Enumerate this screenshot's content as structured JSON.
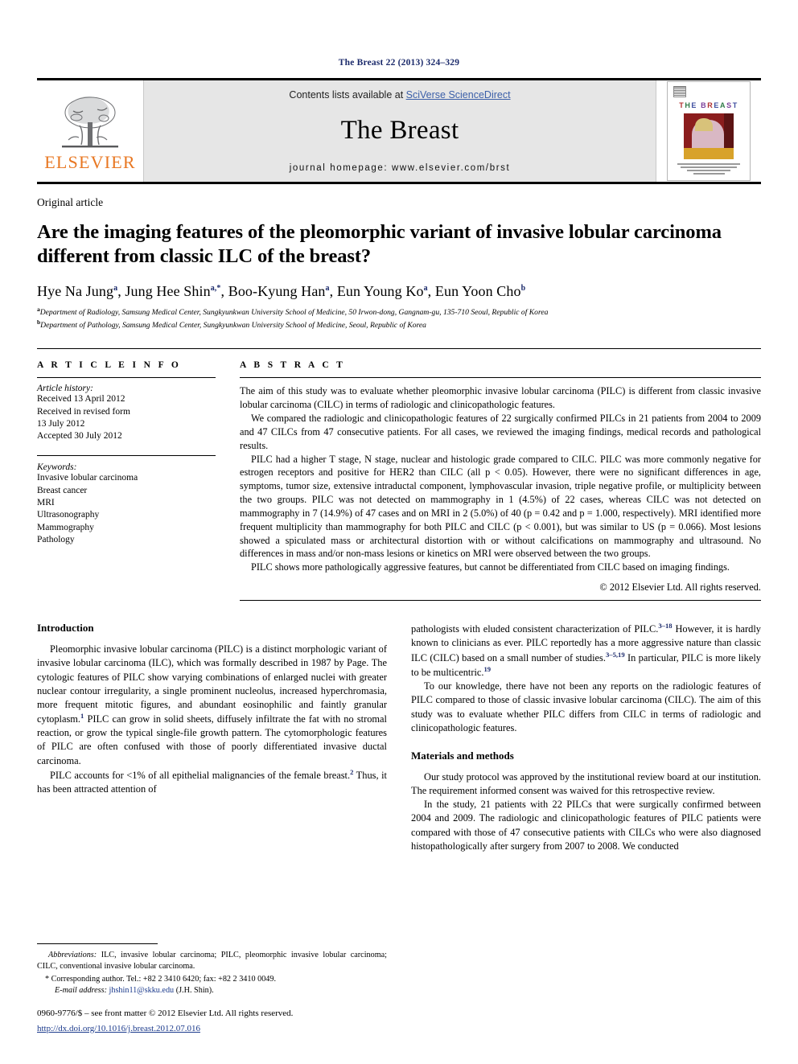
{
  "running_head": "The Breast 22 (2013) 324–329",
  "masthead": {
    "contents_prefix": "Contents lists available at ",
    "sciencedirect": "SciVerse ScienceDirect",
    "journal_name": "The Breast",
    "homepage": "journal homepage: www.elsevier.com/brst",
    "publisher_logo_text": "ELSEVIER",
    "cover_title_parts": [
      "T",
      "H",
      "E",
      "B",
      "R",
      "E",
      "A",
      "S",
      "T"
    ]
  },
  "article": {
    "type": "Original article",
    "title": "Are the imaging features of the pleomorphic variant of invasive lobular carcinoma different from classic ILC of the breast?",
    "authors_html": "Hye Na Jung a, Jung Hee Shin a,*, Boo-Kyung Han a, Eun Young Ko a, Eun Yoon Cho b",
    "affiliation_a": "Department of Radiology, Samsung Medical Center, Sungkyunkwan University School of Medicine, 50 Irwon-dong, Gangnam-gu, 135-710 Seoul, Republic of Korea",
    "affiliation_b": "Department of Pathology, Samsung Medical Center, Sungkyunkwan University School of Medicine, Seoul, Republic of Korea"
  },
  "article_info": {
    "heading": "A R T I C L E   I N F O",
    "history_title": "Article history:",
    "history": [
      "Received 13 April 2012",
      "Received in revised form",
      "13 July 2012",
      "Accepted 30 July 2012"
    ],
    "keywords_title": "Keywords:",
    "keywords": [
      "Invasive lobular carcinoma",
      "Breast cancer",
      "MRI",
      "Ultrasonography",
      "Mammography",
      "Pathology"
    ]
  },
  "abstract": {
    "heading": "A B S T R A C T",
    "paragraphs": [
      "The aim of this study was to evaluate whether pleomorphic invasive lobular carcinoma (PILC) is different from classic invasive lobular carcinoma (CILC) in terms of radiologic and clinicopathologic features.",
      "We compared the radiologic and clinicopathologic features of 22 surgically confirmed PILCs in 21 patients from 2004 to 2009 and 47 CILCs from 47 consecutive patients. For all cases, we reviewed the imaging findings, medical records and pathological results.",
      "PILC had a higher T stage, N stage, nuclear and histologic grade compared to CILC. PILC was more commonly negative for estrogen receptors and positive for HER2 than CILC (all p < 0.05). However, there were no significant differences in age, symptoms, tumor size, extensive intraductal component, lymphovascular invasion, triple negative profile, or multiplicity between the two groups. PILC was not detected on mammography in 1 (4.5%) of 22 cases, whereas CILC was not detected on mammography in 7 (14.9%) of 47 cases and on MRI in 2 (5.0%) of 40 (p = 0.42 and p = 1.000, respectively). MRI identified more frequent multiplicity than mammography for both PILC and CILC (p < 0.001), but was similar to US (p = 0.066). Most lesions showed a spiculated mass or architectural distortion with or without calcifications on mammography and ultrasound. No differences in mass and/or non-mass lesions or kinetics on MRI were observed between the two groups.",
      "PILC shows more pathologically aggressive features, but cannot be differentiated from CILC based on imaging findings."
    ],
    "copyright": "© 2012 Elsevier Ltd. All rights reserved."
  },
  "body": {
    "intro_heading": "Introduction",
    "intro_p1": "Pleomorphic invasive lobular carcinoma (PILC) is a distinct morphologic variant of invasive lobular carcinoma (ILC), which was formally described in 1987 by Page. The cytologic features of PILC show varying combinations of enlarged nuclei with greater nuclear contour irregularity, a single prominent nucleolus, increased hyperchromasia, more frequent mitotic figures, and abundant eosinophilic and faintly granular cytoplasm.1 PILC can grow in solid sheets, diffusely infiltrate the fat with no stromal reaction, or grow the typical single-file growth pattern. The cytomorphologic features of PILC are often confused with those of poorly differentiated invasive ductal carcinoma.",
    "intro_p2": "PILC accounts for <1% of all epithelial malignancies of the female breast.2 Thus, it has been attracted attention of",
    "intro_p3": "pathologists with eluded consistent characterization of PILC.3–18 However, it is hardly known to clinicians as ever. PILC reportedly has a more aggressive nature than classic ILC (CILC) based on a small number of studies.3–5,19 In particular, PILC is more likely to be multicentric.19",
    "intro_p4": "To our knowledge, there have not been any reports on the radiologic features of PILC compared to those of classic invasive lobular carcinoma (CILC). The aim of this study was to evaluate whether PILC differs from CILC in terms of radiologic and clinicopathologic features.",
    "methods_heading": "Materials and methods",
    "methods_p1": "Our study protocol was approved by the institutional review board at our institution. The requirement informed consent was waived for this retrospective review.",
    "methods_p2": "In the study, 21 patients with 22 PILCs that were surgically confirmed between 2004 and 2009. The radiologic and clinicopathologic features of PILC patients were compared with those of 47 consecutive patients with CILCs who were also diagnosed histopathologically after surgery from 2007 to 2008. We conducted"
  },
  "footnotes": {
    "abbrev_label": "Abbreviations:",
    "abbrev_text": " ILC, invasive lobular carcinoma; PILC, pleomorphic invasive lobular carcinoma; CILC, conventional invasive lobular carcinoma.",
    "corresponding": "* Corresponding author. Tel.: +82 2 3410 6420; fax: +82 2 3410 0049.",
    "email_label": "E-mail address:",
    "email_address": "jhshin11@skku.edu",
    "email_suffix": " (J.H. Shin).",
    "issn_line": "0960-9776/$ – see front matter © 2012 Elsevier Ltd. All rights reserved.",
    "doi_line": "http://dx.doi.org/10.1016/j.breast.2012.07.016"
  },
  "colors": {
    "running_head": "#1b2a6b",
    "elsevier_orange": "#e87722",
    "link_blue": "#1b3a8c",
    "masthead_gray": "#e6e6e6"
  }
}
